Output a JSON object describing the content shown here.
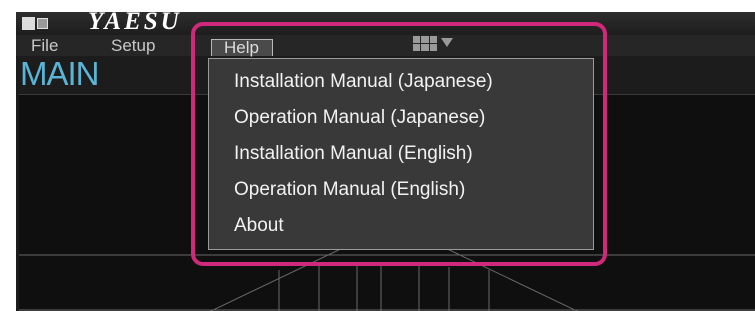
{
  "brand": {
    "name": "YAESU"
  },
  "menubar": {
    "file_label": "File",
    "setup_label": "Setup",
    "help_label": "Help",
    "view_toggle_icon": "grid-icon",
    "view_toggle_arrow": "caret-down-icon"
  },
  "panel": {
    "label": "MAIN"
  },
  "help_menu": {
    "items": [
      {
        "label": "Installation Manual (Japanese)"
      },
      {
        "label": "Operation Manual (Japanese)"
      },
      {
        "label": "Installation Manual (English)"
      },
      {
        "label": "Operation Manual (English)"
      },
      {
        "label": "About"
      }
    ]
  },
  "annotation": {
    "highlight_color": "#d0287a"
  },
  "colors": {
    "panel_label": "#5ab4d6",
    "menu_bg": "#393939",
    "app_bg": "#1c1c1c"
  }
}
